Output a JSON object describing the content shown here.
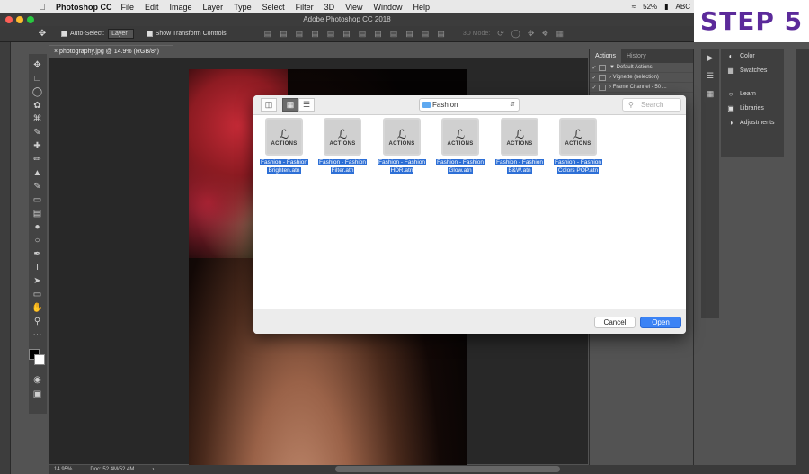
{
  "menubar": {
    "app_name": "Photoshop CC",
    "items": [
      "File",
      "Edit",
      "Image",
      "Layer",
      "Type",
      "Select",
      "Filter",
      "3D",
      "View",
      "Window",
      "Help"
    ],
    "battery": "52%",
    "input_source": "ABC"
  },
  "badge": {
    "text": "STEP 5"
  },
  "window": {
    "title": "Adobe Photoshop CC 2018"
  },
  "options": {
    "auto_select_label": "Auto-Select:",
    "auto_select_value": "Layer",
    "transform_label": "Show Transform Controls",
    "mode_3d_label": "3D Mode:"
  },
  "document": {
    "tab_title": "photography.jpg @ 14.9% (RGB/8*)"
  },
  "actions_panel": {
    "tabs": [
      "Actions",
      "History"
    ],
    "rows": [
      {
        "label": "Default Actions"
      },
      {
        "label": "Vignette (selection)"
      },
      {
        "label": "Frame Channel - 50 ..."
      }
    ]
  },
  "right_panels": {
    "items": [
      {
        "label": "Color",
        "icon": "color-wheel-icon"
      },
      {
        "label": "Swatches",
        "icon": "swatches-grid-icon"
      },
      {
        "label": "Learn",
        "icon": "lightbulb-icon"
      },
      {
        "label": "Libraries",
        "icon": "libraries-icon"
      },
      {
        "label": "Adjustments",
        "icon": "adjustments-icon"
      }
    ]
  },
  "dialog": {
    "location": "Fashion",
    "search_placeholder": "Search",
    "thumb_label": "ACTIONS",
    "files": [
      {
        "line1": "Fashion - Fashion",
        "line2": "Brighten.atn"
      },
      {
        "line1": "Fashion - Fashion",
        "line2": "Filter.atn"
      },
      {
        "line1": "Fashion - Fashion",
        "line2": "HDR.atn"
      },
      {
        "line1": "Fashion - Fashion",
        "line2": "Glow.atn"
      },
      {
        "line1": "Fashion - Fashion",
        "line2": "B&W.atn"
      },
      {
        "line1": "Fashion - Fashion",
        "line2": "Colors POP.atn"
      }
    ],
    "cancel_label": "Cancel",
    "open_label": "Open"
  },
  "status": {
    "zoom": "14.95%",
    "doc_size": "Doc: 52.4M/52.4M"
  },
  "colors": {
    "accent": "#3b83f5",
    "badge_text": "#5b2a9a",
    "selection": "#2d6fd6"
  }
}
